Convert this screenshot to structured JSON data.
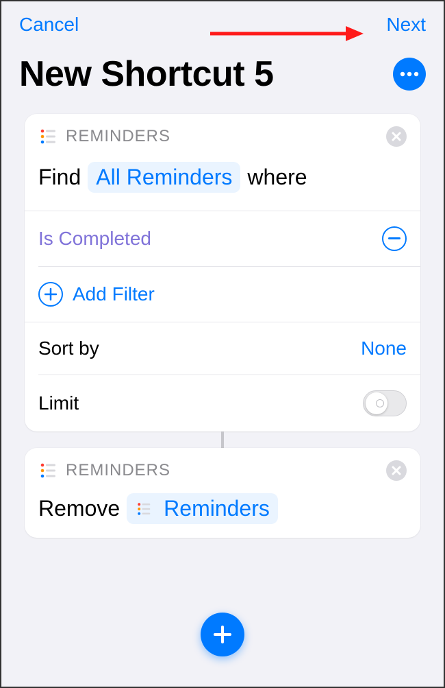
{
  "nav": {
    "cancel": "Cancel",
    "next": "Next"
  },
  "title": "New Shortcut 5",
  "action1": {
    "app": "REMINDERS",
    "verb": "Find",
    "scope_token": "All Reminders",
    "suffix": "where",
    "filters": [
      {
        "label": "Is Completed"
      }
    ],
    "add_filter": "Add Filter",
    "sort_label": "Sort by",
    "sort_value": "None",
    "limit_label": "Limit",
    "limit_on": false
  },
  "action2": {
    "app": "REMINDERS",
    "verb": "Remove",
    "target_token": "Reminders"
  }
}
